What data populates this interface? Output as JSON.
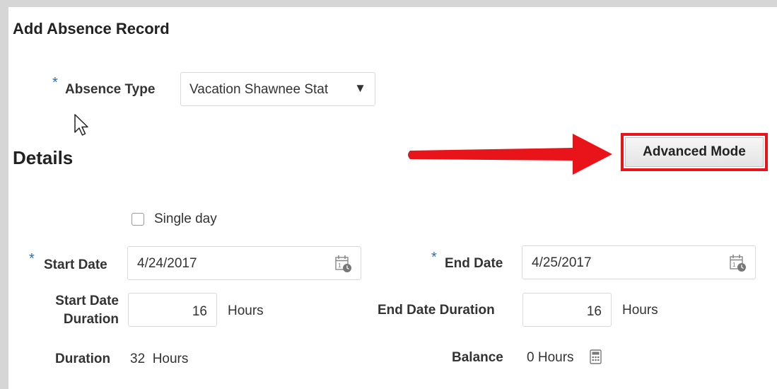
{
  "header": {
    "title": "Add Absence Record"
  },
  "absence_type": {
    "required_marker": "*",
    "label": "Absence Type",
    "value": "Vacation Shawnee Stat",
    "caret": "▼"
  },
  "details": {
    "title": "Details",
    "advanced_mode_label": "Advanced Mode",
    "single_day_label": "Single day",
    "start_date": {
      "required_marker": "*",
      "label": "Start Date",
      "value": "4/24/2017"
    },
    "end_date": {
      "required_marker": "*",
      "label": "End Date",
      "value": "4/25/2017"
    },
    "start_duration": {
      "label_line1": "Start Date",
      "label_line2": "Duration",
      "value": "16",
      "unit": "Hours"
    },
    "end_duration": {
      "label": "End Date Duration",
      "value": "16",
      "unit": "Hours"
    },
    "duration": {
      "label": "Duration",
      "value": "32  Hours"
    },
    "balance": {
      "label": "Balance",
      "value": "0 Hours"
    }
  },
  "colors": {
    "required": "#2f6fa7",
    "highlight": "#e8141a"
  },
  "icons": [
    "calendar-icon",
    "calculator-icon",
    "mouse-cursor-icon",
    "red-arrow"
  ]
}
